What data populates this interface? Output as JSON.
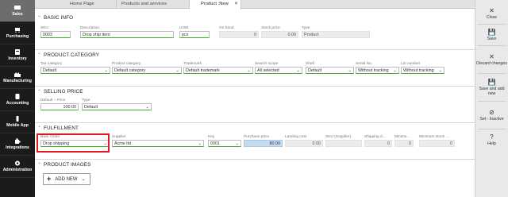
{
  "nav": [
    {
      "label": "Sales"
    },
    {
      "label": "Purchasing"
    },
    {
      "label": "Inventory"
    },
    {
      "label": "Manufacturing"
    },
    {
      "label": "Accounting"
    },
    {
      "label": "Mobile App"
    },
    {
      "label": "Integrations"
    },
    {
      "label": "Administration"
    }
  ],
  "tabs": [
    {
      "label": "Home Page"
    },
    {
      "label": "Products and services"
    },
    {
      "label": "Product :New",
      "close": "✕"
    }
  ],
  "basic_info": {
    "title": "BASIC INFO",
    "sku": {
      "label": "SKU",
      "value": "0003"
    },
    "description": {
      "label": "Description",
      "value": "Drop ship item"
    },
    "uom": {
      "label": "UOM",
      "value": "pcs"
    },
    "on_hand": {
      "label": "On hand",
      "value": "0"
    },
    "stock_price": {
      "label": "Stock price",
      "value": "0.00"
    },
    "type": {
      "label": "Type",
      "value": "Product"
    }
  },
  "product_category": {
    "title": "PRODUCT CATEGORY",
    "tax_category": {
      "label": "Tax category",
      "value": "Default"
    },
    "product_category": {
      "label": "Product category",
      "value": "Default category"
    },
    "trademark": {
      "label": "Trademark",
      "value": "Default trademark"
    },
    "search_scope": {
      "label": "Search scope",
      "value": "All selected"
    },
    "shelf": {
      "label": "Shelf",
      "value": "Default"
    },
    "serial_no": {
      "label": "Serial No.",
      "value": "Without tracking"
    },
    "lot_number": {
      "label": "Lot number",
      "value": "Without tracking"
    }
  },
  "selling_price": {
    "title": "SELLING PRICE",
    "price": {
      "label": "Default – Price",
      "value": "100.00"
    },
    "type": {
      "label": "Type",
      "value": "Default"
    }
  },
  "fulfillment": {
    "title": "FULFILLMENT",
    "back_order": {
      "label": "Back Order",
      "value": "Drop shipping"
    },
    "supplier": {
      "label": "Supplier",
      "value": "Acme ltd"
    },
    "key": {
      "label": "Key",
      "value": "0001"
    },
    "purchase_price": {
      "label": "Purchase price",
      "value": "80.00"
    },
    "landing_cost": {
      "label": "Landing cost",
      "value": "0.00"
    },
    "sku_supplier": {
      "label": "SKU (Supplier)",
      "value": ""
    },
    "shipping_days": {
      "label": "Shipping d...",
      "value": "0"
    },
    "minimum": {
      "label": "Minimu...",
      "value": "0"
    },
    "minimum_stock": {
      "label": "Minimum stock ...",
      "value": "0"
    }
  },
  "product_images": {
    "title": "PRODUCT IMAGES",
    "add_new": "ADD NEW"
  },
  "actions": [
    {
      "icon": "✕",
      "label": "Close"
    },
    {
      "icon": "💾",
      "label": "Save"
    },
    {
      "icon": "✕",
      "label": "Discard changes"
    },
    {
      "icon": "💾",
      "label": "Save and add new"
    },
    {
      "icon": "⊘",
      "label": "Set - Inactive"
    },
    {
      "icon": "?",
      "label": "Help"
    }
  ],
  "colors": {
    "nav_bg": "#1b1b1b",
    "nav_active": "#6d6d6d",
    "highlight_border": "#e01a22",
    "valid_underline": "#3fae2a",
    "purchase_price_bg": "#c5dcf0"
  }
}
